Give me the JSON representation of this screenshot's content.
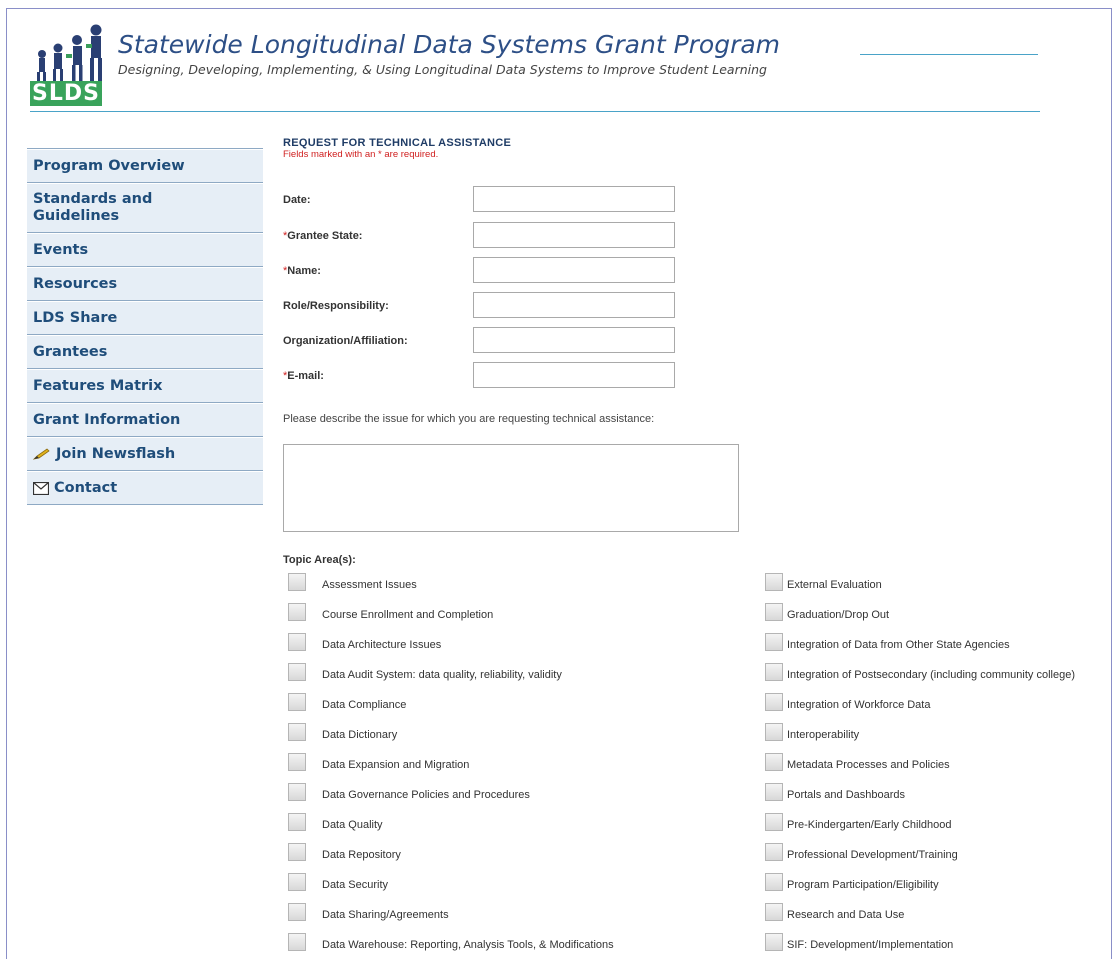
{
  "header": {
    "logo_text": "SLDS",
    "title": "Statewide Longitudinal Data Systems Grant Program",
    "subtitle": "Designing, Developing, Implementing, & Using Longitudinal Data Systems to Improve Student Learning"
  },
  "sidebar": {
    "items": [
      {
        "label": "Program Overview"
      },
      {
        "label": "Standards and Guidelines"
      },
      {
        "label": "Events"
      },
      {
        "label": "Resources"
      },
      {
        "label": "LDS Share"
      },
      {
        "label": "Grantees"
      },
      {
        "label": "Features Matrix"
      },
      {
        "label": "Grant Information"
      },
      {
        "label": "Join Newsflash",
        "icon": "pencil-icon"
      },
      {
        "label": "Contact",
        "icon": "envelope-icon"
      }
    ]
  },
  "form": {
    "title": "REQUEST FOR TECHNICAL ASSISTANCE",
    "required_note": "Fields marked with an * are required.",
    "fields": [
      {
        "label": "Date:",
        "required": false,
        "value": ""
      },
      {
        "label": "Grantee State:",
        "required": true,
        "value": ""
      },
      {
        "label": "Name:",
        "required": true,
        "value": ""
      },
      {
        "label": "Role/Responsibility:",
        "required": false,
        "value": ""
      },
      {
        "label": "Organization/Affiliation:",
        "required": false,
        "value": ""
      },
      {
        "label": "E-mail:",
        "required": true,
        "value": ""
      }
    ],
    "describe_label": "Please describe the issue for which you are requesting technical assistance:",
    "topic_label": "Topic Area(s):",
    "topics_left": [
      "Assessment Issues",
      "Course Enrollment and Completion",
      "Data Architecture Issues",
      "Data Audit System: data quality, reliability, validity",
      "Data Compliance",
      "Data Dictionary",
      "Data Expansion and Migration",
      "Data Governance Policies and Procedures",
      "Data Quality",
      "Data Repository",
      "Data Security",
      "Data Sharing/Agreements",
      "Data Warehouse: Reporting, Analysis Tools, & Modifications"
    ],
    "topics_right": [
      "External Evaluation",
      "Graduation/Drop Out",
      "Integration of Data from Other State Agencies",
      "Integration of Postsecondary (including community college)",
      "Integration of Workforce Data",
      " Interoperability",
      "Metadata Processes and Policies",
      "Portals and Dashboards",
      "Pre-Kindergarten/Early Childhood",
      "Professional Development/Training",
      "Program Participation/Eligibility",
      "Research and Data Use",
      "SIF: Development/Implementation"
    ]
  }
}
